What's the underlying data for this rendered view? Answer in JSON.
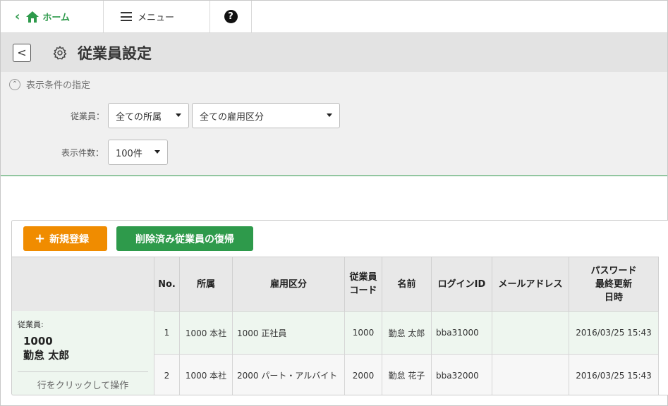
{
  "topnav": {
    "home_label": "ホーム",
    "menu_label": "メニュー",
    "help_label": "?"
  },
  "titlebar": {
    "back_label": "<",
    "title": "従業員設定"
  },
  "filter": {
    "toggle_label": "表示条件の指定",
    "employee_label": "従業員：",
    "department_value": "全ての所属",
    "employment_value": "全ての雇用区分",
    "count_label": "表示件数：",
    "count_value": "100件"
  },
  "actions": {
    "new_label": "新規登録",
    "restore_label": "削除済み従業員の復帰"
  },
  "selection": {
    "label": "従業員:",
    "code": "1000",
    "name": "勤怠 太郎",
    "hint": "行をクリックして操作"
  },
  "table": {
    "headers": {
      "no": "No.",
      "dept": "所属",
      "emp_type": "雇用区分",
      "code_l1": "従業員",
      "code_l2": "コード",
      "name": "名前",
      "login": "ログインID",
      "mail": "メールアドレス",
      "pw_l1": "パスワード",
      "pw_l2": "最終更新",
      "pw_l3": "日時"
    },
    "rows": [
      {
        "no": "1",
        "dept": "1000 本社",
        "emp_type": "1000 正社員",
        "code": "1000",
        "name": "勤怠 太郎",
        "login": "bba31000",
        "mail": "",
        "updated": "2016/03/25 15:43"
      },
      {
        "no": "2",
        "dept": "1000 本社",
        "emp_type": "2000 パート・アルバイト",
        "code": "2000",
        "name": "勤怠 花子",
        "login": "bba32000",
        "mail": "",
        "updated": "2016/03/25 15:43"
      }
    ]
  },
  "colors": {
    "brand_green": "#2e9a4b",
    "accent_orange": "#f08c00"
  }
}
